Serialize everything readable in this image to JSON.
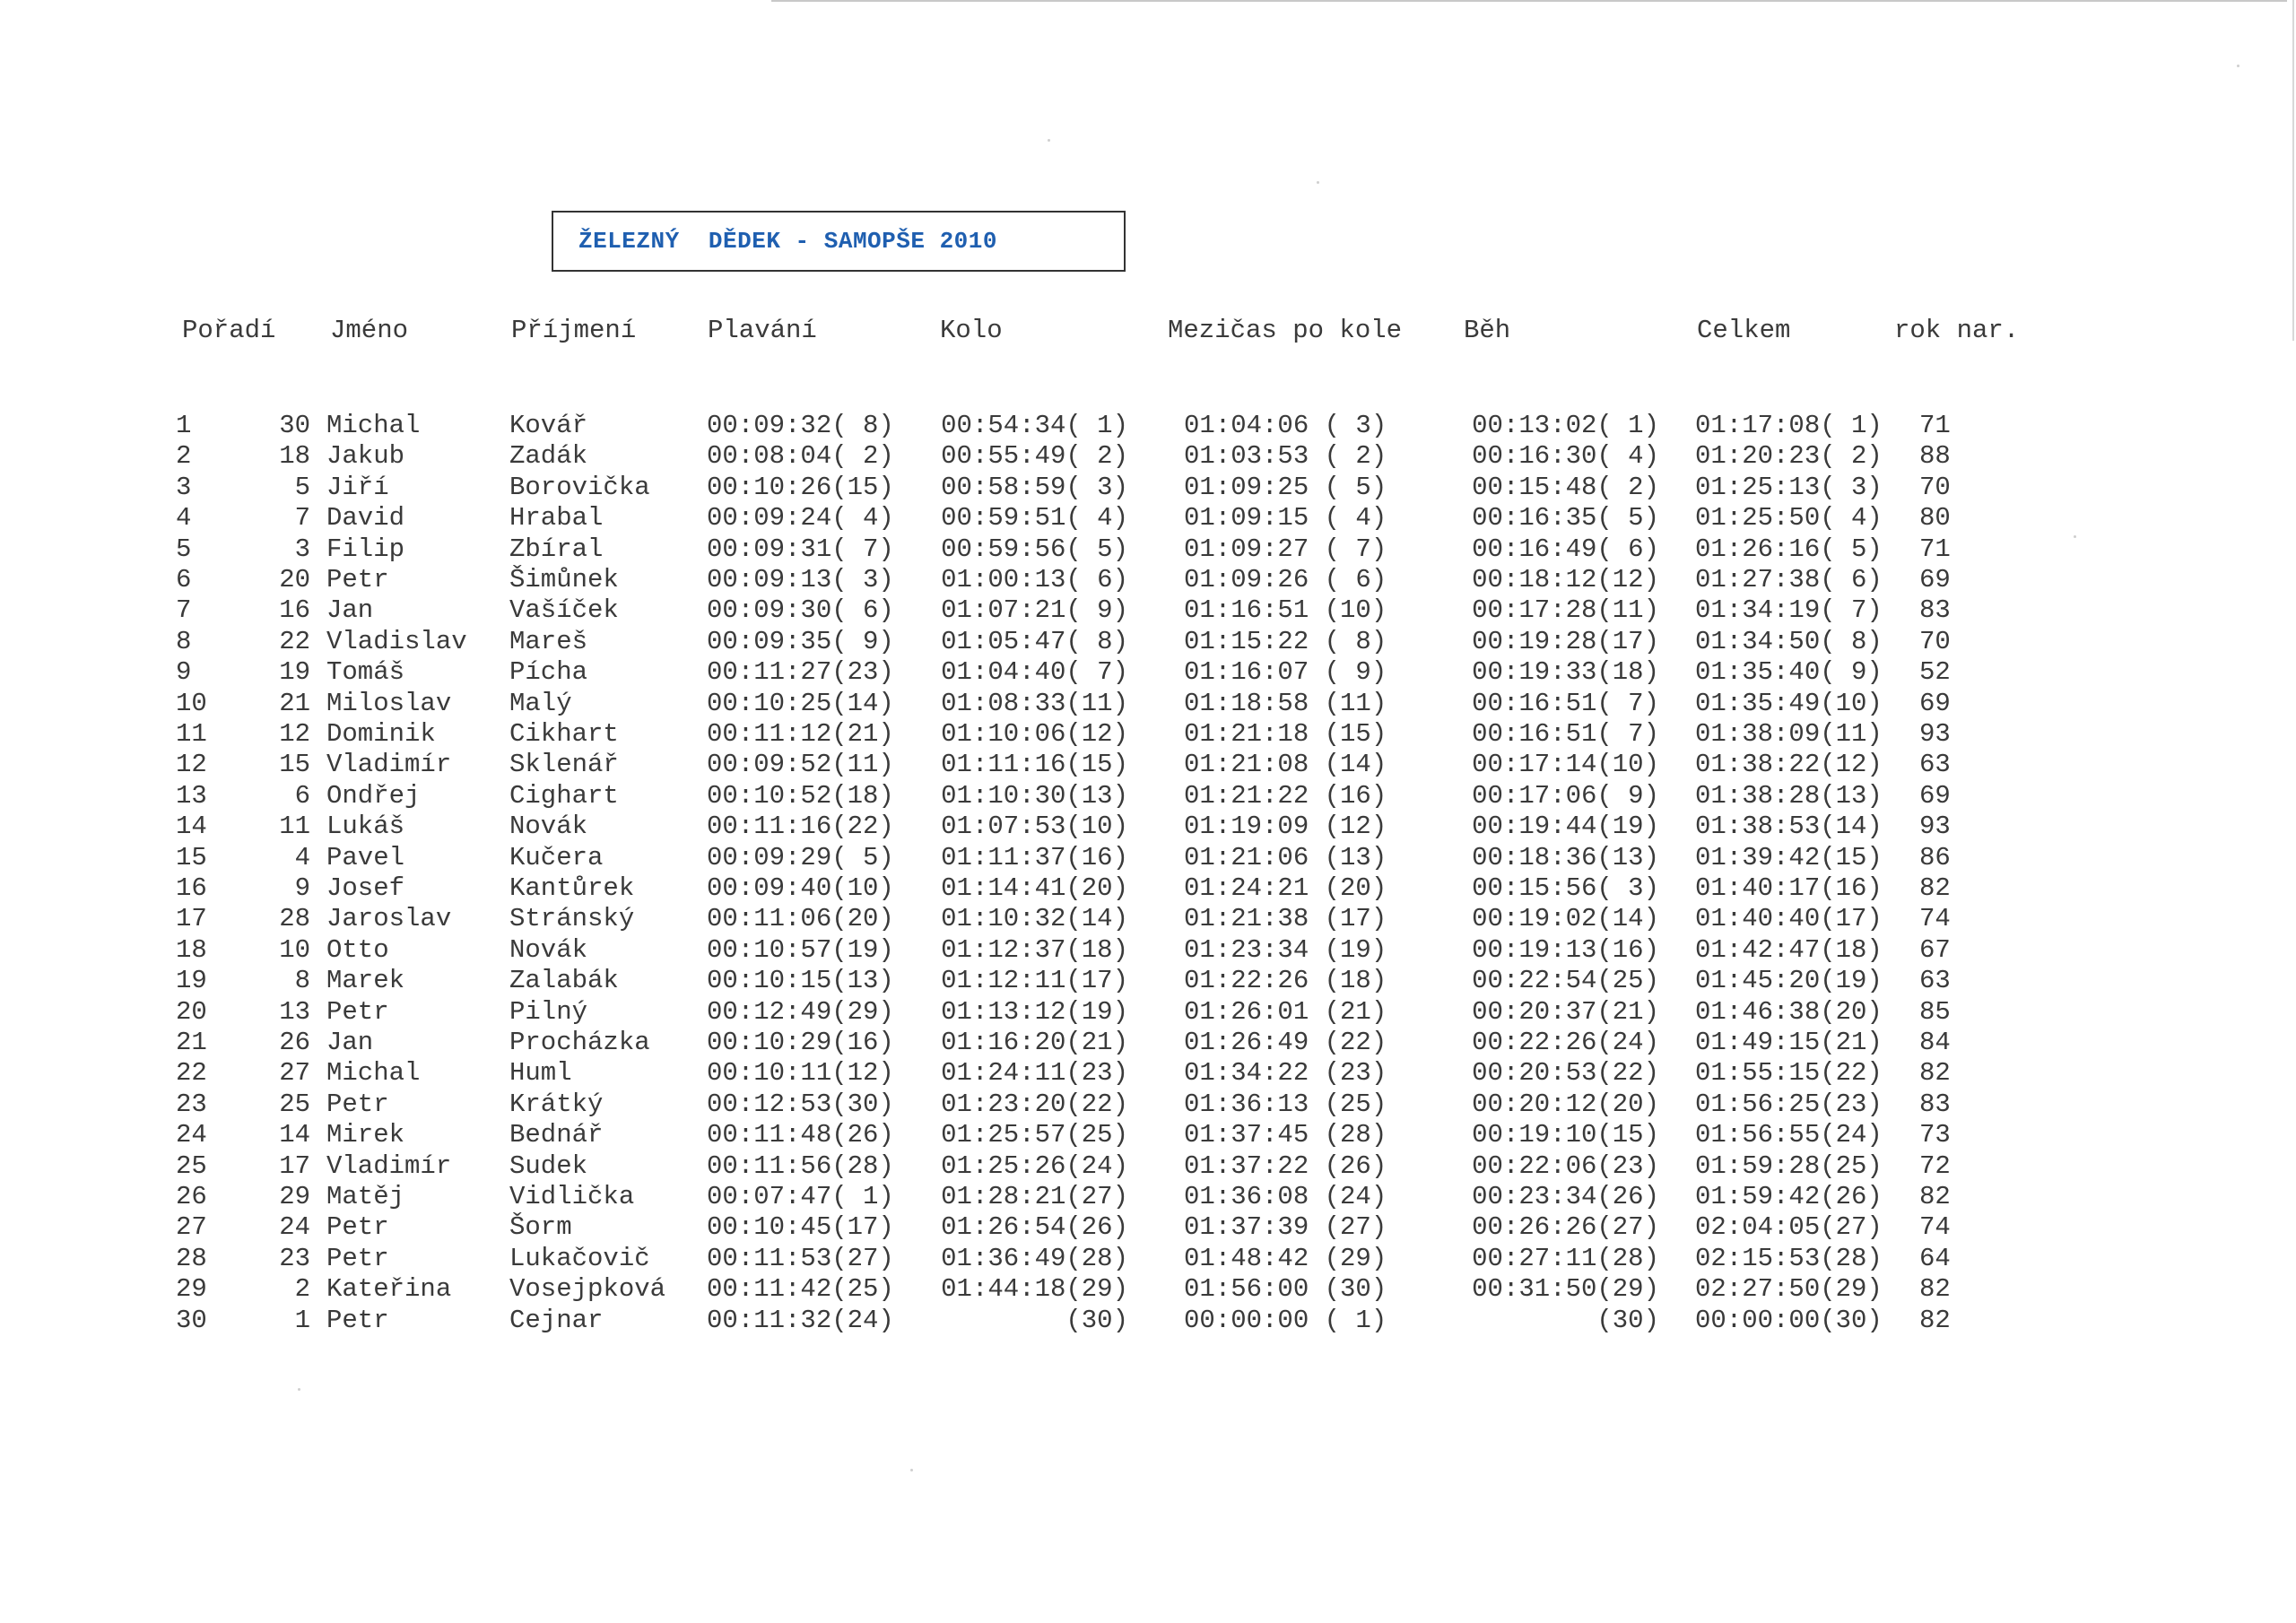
{
  "title": "ŽELEZNÝ  DĚDEK - SAMOPŠE 2010",
  "headers": {
    "poradi": "Pořadí",
    "jmeno": "Jméno",
    "prijmeni": "Příjmení",
    "plavani": "Plavání",
    "kolo": "Kolo",
    "mezicas": "Mezičas po kole",
    "beh": "Běh",
    "celkem": "Celkem",
    "rok": "rok nar."
  },
  "rows": [
    {
      "poradi": "1",
      "cislo": "30",
      "jmeno": "Michal",
      "prijmeni": "Kovář",
      "plavani": "00:09:32( 8)",
      "kolo": "00:54:34( 1)",
      "mezicas": "01:04:06 ( 3)",
      "beh": "00:13:02( 1)",
      "celkem": "01:17:08( 1)",
      "rok": "71"
    },
    {
      "poradi": "2",
      "cislo": "18",
      "jmeno": "Jakub",
      "prijmeni": "Zadák",
      "plavani": "00:08:04( 2)",
      "kolo": "00:55:49( 2)",
      "mezicas": "01:03:53 ( 2)",
      "beh": "00:16:30( 4)",
      "celkem": "01:20:23( 2)",
      "rok": "88"
    },
    {
      "poradi": "3",
      "cislo": "5",
      "jmeno": "Jiří",
      "prijmeni": "Borovička",
      "plavani": "00:10:26(15)",
      "kolo": "00:58:59( 3)",
      "mezicas": "01:09:25 ( 5)",
      "beh": "00:15:48( 2)",
      "celkem": "01:25:13( 3)",
      "rok": "70"
    },
    {
      "poradi": "4",
      "cislo": "7",
      "jmeno": "David",
      "prijmeni": "Hrabal",
      "plavani": "00:09:24( 4)",
      "kolo": "00:59:51( 4)",
      "mezicas": "01:09:15 ( 4)",
      "beh": "00:16:35( 5)",
      "celkem": "01:25:50( 4)",
      "rok": "80"
    },
    {
      "poradi": "5",
      "cislo": "3",
      "jmeno": "Filip",
      "prijmeni": "Zbíral",
      "plavani": "00:09:31( 7)",
      "kolo": "00:59:56( 5)",
      "mezicas": "01:09:27 ( 7)",
      "beh": "00:16:49( 6)",
      "celkem": "01:26:16( 5)",
      "rok": "71"
    },
    {
      "poradi": "6",
      "cislo": "20",
      "jmeno": "Petr",
      "prijmeni": "Šimůnek",
      "plavani": "00:09:13( 3)",
      "kolo": "01:00:13( 6)",
      "mezicas": "01:09:26 ( 6)",
      "beh": "00:18:12(12)",
      "celkem": "01:27:38( 6)",
      "rok": "69"
    },
    {
      "poradi": "7",
      "cislo": "16",
      "jmeno": "Jan",
      "prijmeni": "Vašíček",
      "plavani": "00:09:30( 6)",
      "kolo": "01:07:21( 9)",
      "mezicas": "01:16:51 (10)",
      "beh": "00:17:28(11)",
      "celkem": "01:34:19( 7)",
      "rok": "83"
    },
    {
      "poradi": "8",
      "cislo": "22",
      "jmeno": "Vladislav",
      "prijmeni": "Mareš",
      "plavani": "00:09:35( 9)",
      "kolo": "01:05:47( 8)",
      "mezicas": "01:15:22 ( 8)",
      "beh": "00:19:28(17)",
      "celkem": "01:34:50( 8)",
      "rok": "70"
    },
    {
      "poradi": "9",
      "cislo": "19",
      "jmeno": "Tomáš",
      "prijmeni": "Pícha",
      "plavani": "00:11:27(23)",
      "kolo": "01:04:40( 7)",
      "mezicas": "01:16:07 ( 9)",
      "beh": "00:19:33(18)",
      "celkem": "01:35:40( 9)",
      "rok": "52"
    },
    {
      "poradi": "10",
      "cislo": "21",
      "jmeno": "Miloslav",
      "prijmeni": "Malý",
      "plavani": "00:10:25(14)",
      "kolo": "01:08:33(11)",
      "mezicas": "01:18:58 (11)",
      "beh": "00:16:51( 7)",
      "celkem": "01:35:49(10)",
      "rok": "69"
    },
    {
      "poradi": "11",
      "cislo": "12",
      "jmeno": "Dominik",
      "prijmeni": "Cikhart",
      "plavani": "00:11:12(21)",
      "kolo": "01:10:06(12)",
      "mezicas": "01:21:18 (15)",
      "beh": "00:16:51( 7)",
      "celkem": "01:38:09(11)",
      "rok": "93"
    },
    {
      "poradi": "12",
      "cislo": "15",
      "jmeno": "Vladimír",
      "prijmeni": "Sklenář",
      "plavani": "00:09:52(11)",
      "kolo": "01:11:16(15)",
      "mezicas": "01:21:08 (14)",
      "beh": "00:17:14(10)",
      "celkem": "01:38:22(12)",
      "rok": "63"
    },
    {
      "poradi": "13",
      "cislo": "6",
      "jmeno": "Ondřej",
      "prijmeni": "Cighart",
      "plavani": "00:10:52(18)",
      "kolo": "01:10:30(13)",
      "mezicas": "01:21:22 (16)",
      "beh": "00:17:06( 9)",
      "celkem": "01:38:28(13)",
      "rok": "69"
    },
    {
      "poradi": "14",
      "cislo": "11",
      "jmeno": "Lukáš",
      "prijmeni": "Novák",
      "plavani": "00:11:16(22)",
      "kolo": "01:07:53(10)",
      "mezicas": "01:19:09 (12)",
      "beh": "00:19:44(19)",
      "celkem": "01:38:53(14)",
      "rok": "93"
    },
    {
      "poradi": "15",
      "cislo": "4",
      "jmeno": "Pavel",
      "prijmeni": "Kučera",
      "plavani": "00:09:29( 5)",
      "kolo": "01:11:37(16)",
      "mezicas": "01:21:06 (13)",
      "beh": "00:18:36(13)",
      "celkem": "01:39:42(15)",
      "rok": "86"
    },
    {
      "poradi": "16",
      "cislo": "9",
      "jmeno": "Josef",
      "prijmeni": "Kantůrek",
      "plavani": "00:09:40(10)",
      "kolo": "01:14:41(20)",
      "mezicas": "01:24:21 (20)",
      "beh": "00:15:56( 3)",
      "celkem": "01:40:17(16)",
      "rok": "82"
    },
    {
      "poradi": "17",
      "cislo": "28",
      "jmeno": "Jaroslav",
      "prijmeni": "Stránský",
      "plavani": "00:11:06(20)",
      "kolo": "01:10:32(14)",
      "mezicas": "01:21:38 (17)",
      "beh": "00:19:02(14)",
      "celkem": "01:40:40(17)",
      "rok": "74"
    },
    {
      "poradi": "18",
      "cislo": "10",
      "jmeno": "Otto",
      "prijmeni": "Novák",
      "plavani": "00:10:57(19)",
      "kolo": "01:12:37(18)",
      "mezicas": "01:23:34 (19)",
      "beh": "00:19:13(16)",
      "celkem": "01:42:47(18)",
      "rok": "67"
    },
    {
      "poradi": "19",
      "cislo": "8",
      "jmeno": "Marek",
      "prijmeni": "Zalabák",
      "plavani": "00:10:15(13)",
      "kolo": "01:12:11(17)",
      "mezicas": "01:22:26 (18)",
      "beh": "00:22:54(25)",
      "celkem": "01:45:20(19)",
      "rok": "63"
    },
    {
      "poradi": "20",
      "cislo": "13",
      "jmeno": "Petr",
      "prijmeni": "Pilný",
      "plavani": "00:12:49(29)",
      "kolo": "01:13:12(19)",
      "mezicas": "01:26:01 (21)",
      "beh": "00:20:37(21)",
      "celkem": "01:46:38(20)",
      "rok": "85"
    },
    {
      "poradi": "21",
      "cislo": "26",
      "jmeno": "Jan",
      "prijmeni": "Procházka",
      "plavani": "00:10:29(16)",
      "kolo": "01:16:20(21)",
      "mezicas": "01:26:49 (22)",
      "beh": "00:22:26(24)",
      "celkem": "01:49:15(21)",
      "rok": "84"
    },
    {
      "poradi": "22",
      "cislo": "27",
      "jmeno": "Michal",
      "prijmeni": "Huml",
      "plavani": "00:10:11(12)",
      "kolo": "01:24:11(23)",
      "mezicas": "01:34:22 (23)",
      "beh": "00:20:53(22)",
      "celkem": "01:55:15(22)",
      "rok": "82"
    },
    {
      "poradi": "23",
      "cislo": "25",
      "jmeno": "Petr",
      "prijmeni": "Krátký",
      "plavani": "00:12:53(30)",
      "kolo": "01:23:20(22)",
      "mezicas": "01:36:13 (25)",
      "beh": "00:20:12(20)",
      "celkem": "01:56:25(23)",
      "rok": "83"
    },
    {
      "poradi": "24",
      "cislo": "14",
      "jmeno": "Mirek",
      "prijmeni": "Bednář",
      "plavani": "00:11:48(26)",
      "kolo": "01:25:57(25)",
      "mezicas": "01:37:45 (28)",
      "beh": "00:19:10(15)",
      "celkem": "01:56:55(24)",
      "rok": "73"
    },
    {
      "poradi": "25",
      "cislo": "17",
      "jmeno": "Vladimír",
      "prijmeni": "Sudek",
      "plavani": "00:11:56(28)",
      "kolo": "01:25:26(24)",
      "mezicas": "01:37:22 (26)",
      "beh": "00:22:06(23)",
      "celkem": "01:59:28(25)",
      "rok": "72"
    },
    {
      "poradi": "26",
      "cislo": "29",
      "jmeno": "Matěj",
      "prijmeni": "Vidlička",
      "plavani": "00:07:47( 1)",
      "kolo": "01:28:21(27)",
      "mezicas": "01:36:08 (24)",
      "beh": "00:23:34(26)",
      "celkem": "01:59:42(26)",
      "rok": "82"
    },
    {
      "poradi": "27",
      "cislo": "24",
      "jmeno": "Petr",
      "prijmeni": "Šorm",
      "plavani": "00:10:45(17)",
      "kolo": "01:26:54(26)",
      "mezicas": "01:37:39 (27)",
      "beh": "00:26:26(27)",
      "celkem": "02:04:05(27)",
      "rok": "74"
    },
    {
      "poradi": "28",
      "cislo": "23",
      "jmeno": "Petr",
      "prijmeni": "Lukačovič",
      "plavani": "00:11:53(27)",
      "kolo": "01:36:49(28)",
      "mezicas": "01:48:42 (29)",
      "beh": "00:27:11(28)",
      "celkem": "02:15:53(28)",
      "rok": "64"
    },
    {
      "poradi": "29",
      "cislo": "2",
      "jmeno": "Kateřina",
      "prijmeni": "Vosejpková",
      "plavani": "00:11:42(25)",
      "kolo": "01:44:18(29)",
      "mezicas": "01:56:00 (30)",
      "beh": "00:31:50(29)",
      "celkem": "02:27:50(29)",
      "rok": "82"
    },
    {
      "poradi": "30",
      "cislo": "1",
      "jmeno": "Petr",
      "prijmeni": "Cejnar",
      "plavani": "00:11:32(24)",
      "kolo": "(30)",
      "mezicas": "00:00:00 ( 1)",
      "beh": "(30)",
      "celkem": "00:00:00(30)",
      "rok": "82"
    }
  ]
}
